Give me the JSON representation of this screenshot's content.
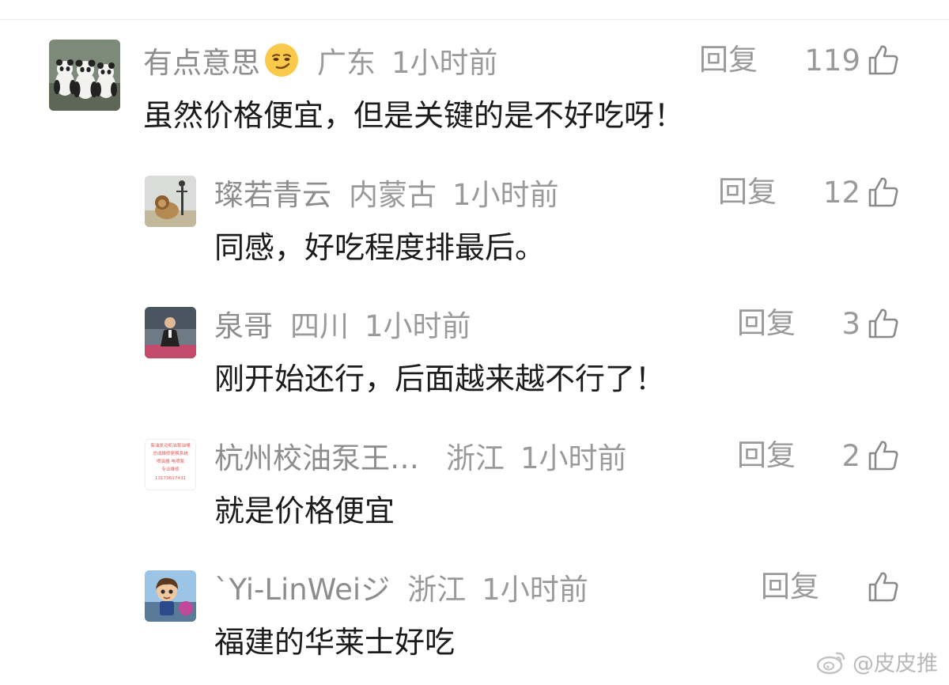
{
  "comments": [
    {
      "username": "有点意思",
      "emoji": "smirk-emoji",
      "location": "广东",
      "time": "1小时前",
      "reply_label": "回复",
      "likes": "119",
      "text": "虽然价格便宜，但是关键的是不好吃呀！"
    },
    {
      "username": "璨若青云",
      "location": "内蒙古",
      "time": "1小时前",
      "reply_label": "回复",
      "likes": "12",
      "text": "同感，好吃程度排最后。"
    },
    {
      "username": "泉哥",
      "location": "四川",
      "time": "1小时前",
      "reply_label": "回复",
      "likes": "3",
      "text": "刚开始还行，后面越来越不行了！"
    },
    {
      "username": "杭州校油泵王…",
      "location": "浙江",
      "time": "1小时前",
      "reply_label": "回复",
      "likes": "2",
      "text": "就是价格便宜",
      "avatar_text": [
        "柴油发动机油泵油嘴",
        "总成维修更换系统",
        "喷油器  电喷泵",
        "专业维修",
        "13173617431"
      ]
    },
    {
      "username": "`Yi-LinWeiジ",
      "location": "浙江",
      "time": "1小时前",
      "reply_label": "回复",
      "likes": "",
      "text": "福建的华莱士好吃"
    }
  ],
  "watermark": {
    "icon": "weibo-icon",
    "text": "@皮皮推"
  },
  "colors": {
    "meta_gray": "#9a9a9a",
    "text_dark": "#1b1b1b",
    "avatar_text_red": "#e25a5a"
  }
}
